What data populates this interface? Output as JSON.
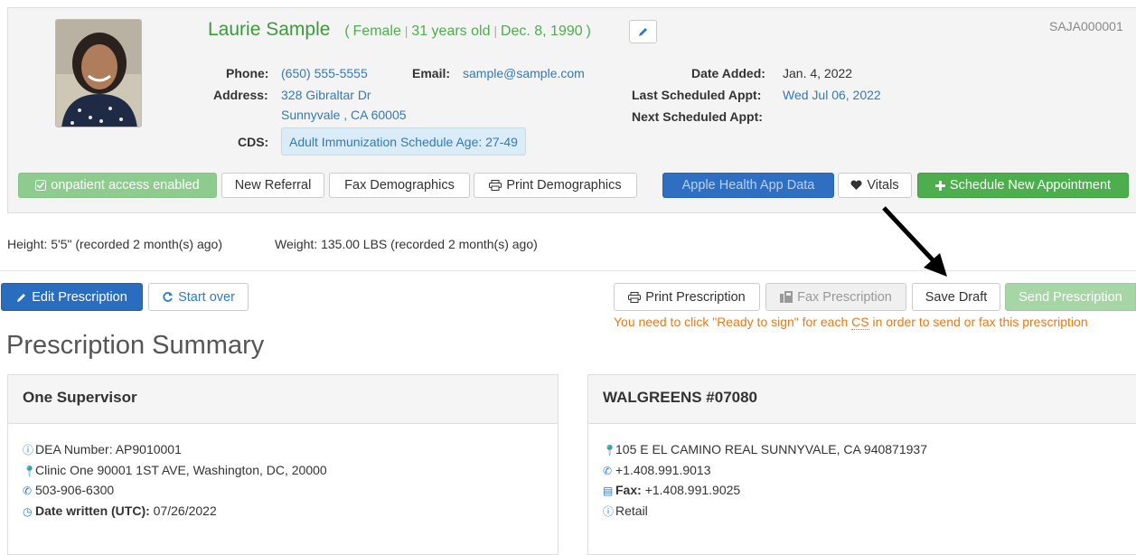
{
  "patient": {
    "name": "Laurie Sample",
    "meta_open": "(",
    "gender": "Female",
    "age": "31 years old",
    "dob": "Dec. 8, 1990",
    "meta_close": ")",
    "sep": "|",
    "id": "SAJA000001"
  },
  "contact": {
    "phone_label": "Phone:",
    "phone": "(650) 555-5555",
    "email_label": "Email:",
    "email": "sample@sample.com",
    "address_label": "Address:",
    "address_line1": "328 Gibraltar Dr",
    "address_line2": "Sunnyvale , CA 60005",
    "cds_label": "CDS:",
    "cds_value": "Adult Immunization Schedule Age: 27-49"
  },
  "dates": {
    "date_added_label": "Date Added:",
    "date_added": "Jan. 4, 2022",
    "last_appt_label": "Last Scheduled Appt:",
    "last_appt": "Wed Jul 06, 2022",
    "next_appt_label": "Next Scheduled Appt:"
  },
  "actions": {
    "onpatient": "onpatient access enabled",
    "new_referral": "New Referral",
    "fax_demographics": "Fax Demographics",
    "print_demographics": "Print Demographics",
    "apple_health": "Apple Health App Data",
    "vitals": "Vitals",
    "schedule": "Schedule New Appointment"
  },
  "vitals": {
    "height": "Height: 5'5\" (recorded 2 month(s) ago)",
    "weight": "Weight: 135.00 LBS (recorded 2 month(s) ago)"
  },
  "rx_toolbar": {
    "edit": "Edit Prescription",
    "start_over": "Start over",
    "print": "Print Prescription",
    "fax": "Fax Prescription",
    "save_draft": "Save Draft",
    "send": "Send Prescription",
    "warning_pre": "You need to click \"Ready to sign\" for each ",
    "warning_cs": "CS",
    "warning_post": " in order to send or fax this prescription"
  },
  "summary": {
    "title": "Prescription Summary",
    "supervisor": {
      "name": "One Supervisor",
      "dea": "DEA Number: AP9010001",
      "clinic": "Clinic One 90001 1ST AVE, Washington, DC, 20000",
      "phone": "503-906-6300",
      "date_label": "Date written (UTC):",
      "date": "07/26/2022"
    },
    "pharmacy": {
      "name": "WALGREENS #07080",
      "address": "105 E EL CAMINO REAL SUNNYVALE, CA 940871937",
      "phone": "+1.408.991.9013",
      "fax_label": "Fax:",
      "fax": "+1.408.991.9025",
      "type": "Retail"
    }
  },
  "colors": {
    "accent_green": "#4cae4c",
    "link_blue": "#337ab7",
    "primary_blue": "#2a6dbf",
    "warning_orange": "#e07b1a"
  }
}
